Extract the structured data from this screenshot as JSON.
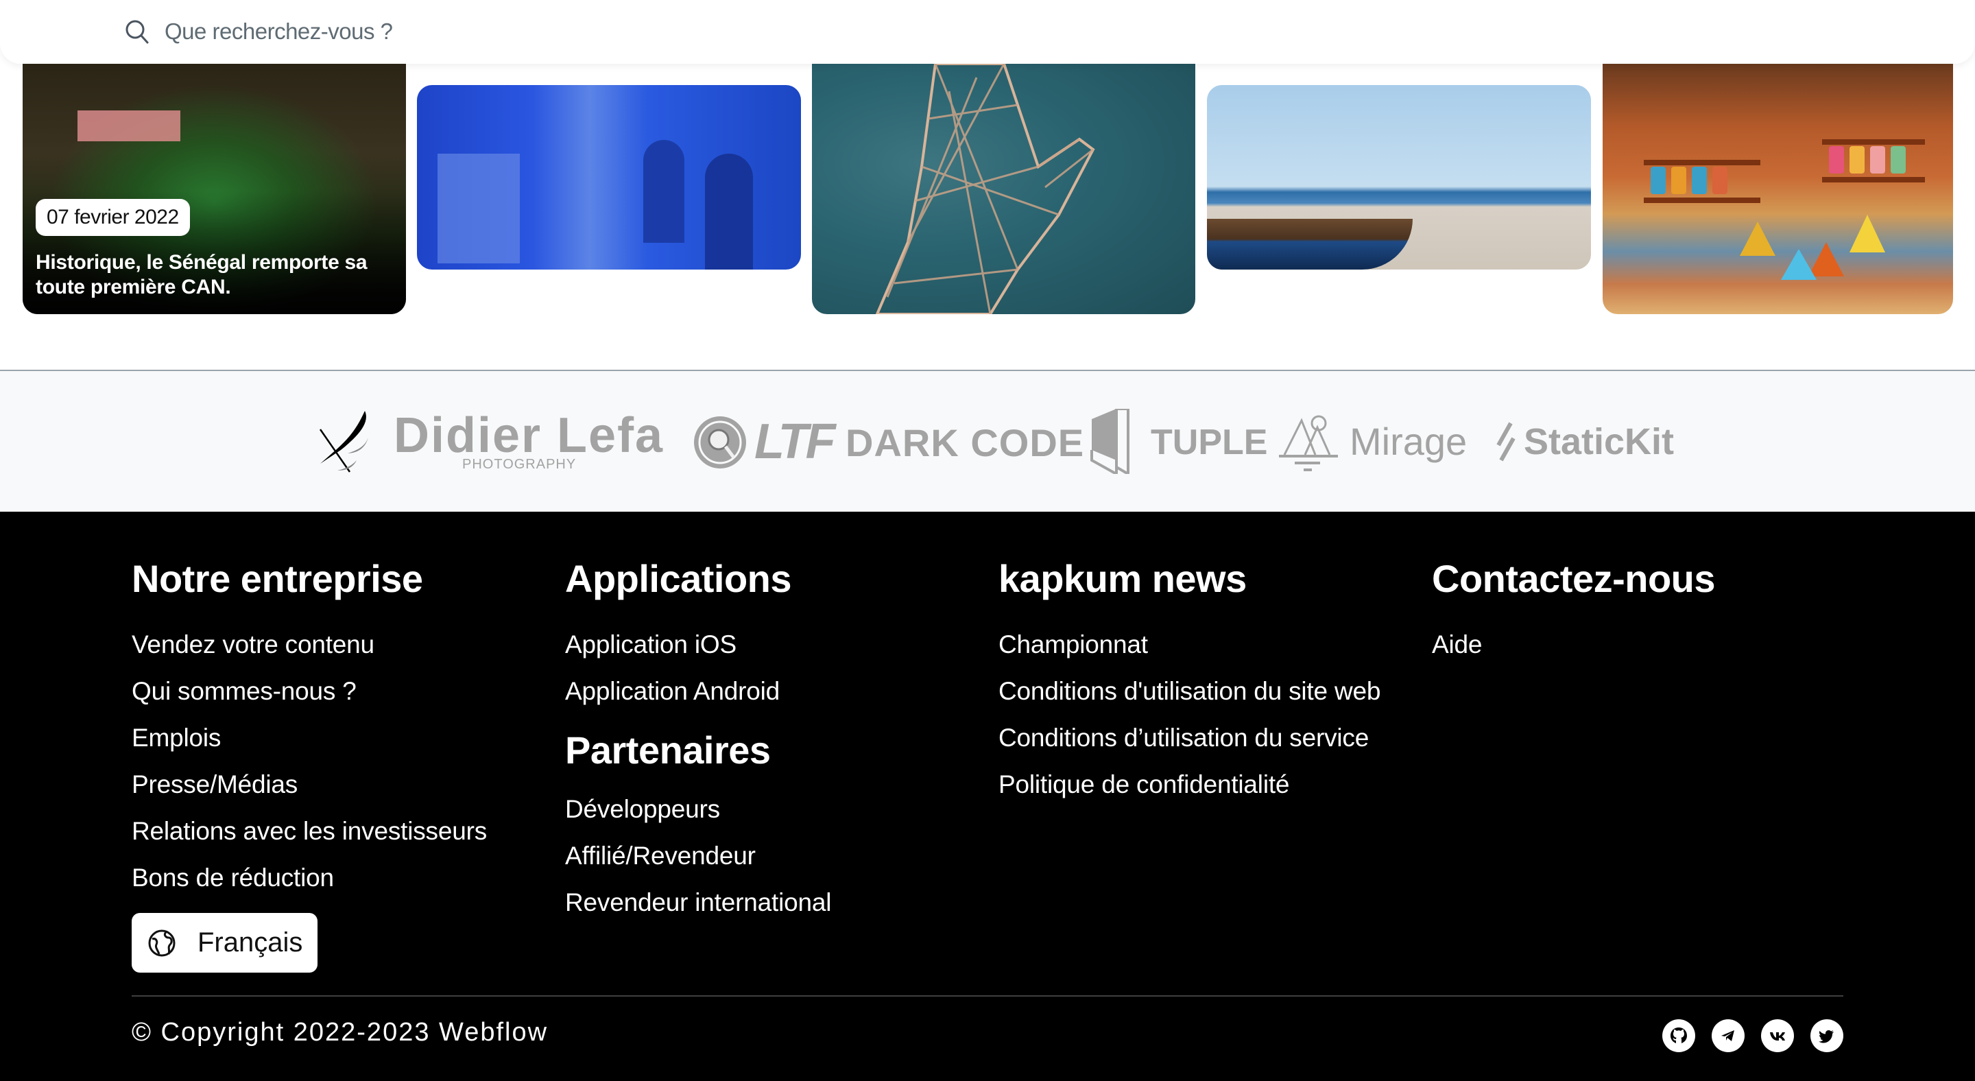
{
  "search": {
    "placeholder": "Que recherchez-vous ?",
    "value": "",
    "icon": "search-icon"
  },
  "cards": [
    {
      "image": "senegal-team-celebration",
      "date": "07 fevrier 2022",
      "title": "Historique, le Sénégal remporte sa toute première CAN."
    },
    {
      "image": "blue-alley-chefchaouen"
    },
    {
      "image": "wire-hand-sculpture"
    },
    {
      "image": "beach-boats"
    },
    {
      "image": "spice-market"
    }
  ],
  "partners": {
    "logos": [
      {
        "name": "Didier Lefa",
        "subtitle": "PHOTOGRAPHY",
        "icon": "bird-icon"
      },
      {
        "name": "LTF",
        "icon": "magnifier-circle-icon"
      },
      {
        "name": "DARK CODE"
      },
      {
        "name": "TUPLE",
        "icon": "door-icon"
      },
      {
        "name": "Mirage",
        "icon": "mountain-icon"
      },
      {
        "name": "StaticKit",
        "icon": "slash-icon"
      }
    ]
  },
  "footer": {
    "columns": [
      {
        "heading": "Notre entreprise",
        "links": [
          "Vendez votre contenu",
          "Qui sommes-nous ?",
          "Emplois",
          "Presse/Médias",
          "Relations avec les investisseurs",
          "Bons de réduction"
        ]
      },
      {
        "heading": "Applications",
        "links": [
          "Application iOS",
          "Application Android"
        ],
        "heading2": "Partenaires",
        "links2": [
          "Développeurs",
          "Affilié/Revendeur",
          "Revendeur international"
        ]
      },
      {
        "heading": "kapkum news",
        "links": [
          "Championnat",
          "Conditions d'utilisation du site web",
          "Conditions d’utilisation du service",
          "Politique de confidentialité"
        ]
      },
      {
        "heading": "Contactez-nous",
        "links": [
          "Aide"
        ]
      }
    ],
    "language_button": {
      "label": "Français",
      "icon": "globe-icon"
    },
    "copyright": "© Copyright 2022-2023 Webflow",
    "socials": [
      "github-icon",
      "telegram-icon",
      "vk-icon",
      "twitter-icon"
    ]
  },
  "colors": {
    "footer_bg": "#000000",
    "logo_strip_bg": "#f8f9fa",
    "logo_gray": "#a3a3a3",
    "placeholder_text": "#5f6b73"
  }
}
